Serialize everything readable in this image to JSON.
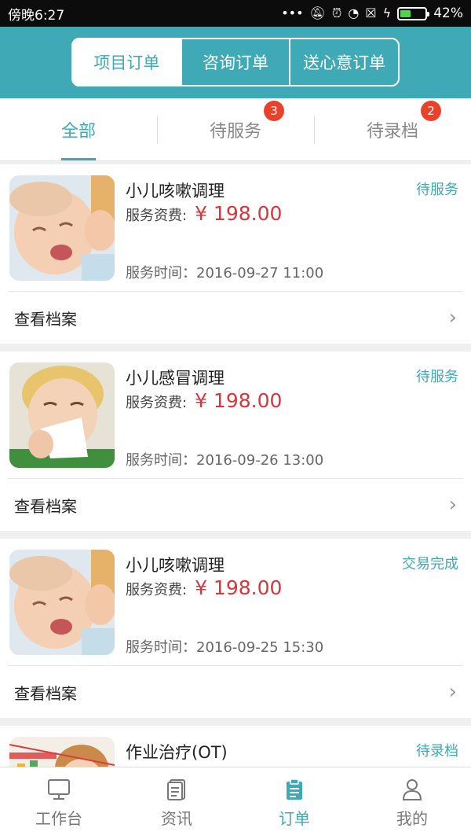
{
  "status_bar": {
    "left_text": "傍晚6:27",
    "battery": "42%",
    "battery_level": 0.42
  },
  "segments": {
    "items": [
      "项目订单",
      "咨询订单",
      "送心意订单"
    ],
    "active": 0
  },
  "subtabs": [
    {
      "label": "全部",
      "badge": ""
    },
    {
      "label": "待服务",
      "badge": "3"
    },
    {
      "label": "待录档",
      "badge": "2"
    }
  ],
  "colors": {
    "accent": "#3fa9b5",
    "price": "#d8363c",
    "badge": "#e8432a"
  },
  "orders": [
    {
      "title": "小儿咳嗽调理",
      "status": "待服务",
      "fee_label": "服务资费:",
      "fee": "¥ 198.00",
      "time": "服务时间：2016-09-27 11:00",
      "action": "查看档案"
    },
    {
      "title": "小儿感冒调理",
      "status": "待服务",
      "fee_label": "服务资费:",
      "fee": "¥ 198.00",
      "time": "服务时间：2016-09-26 13:00",
      "action": "查看档案"
    },
    {
      "title": "小儿咳嗽调理",
      "status": "交易完成",
      "fee_label": "服务资费:",
      "fee": "¥ 198.00",
      "time": "服务时间：2016-09-25 15:30",
      "action": "查看档案"
    },
    {
      "title": "作业治疗(OT)",
      "status": "待录档"
    }
  ],
  "bottom_nav": [
    {
      "label": "工作台",
      "icon": "monitor-icon"
    },
    {
      "label": "资讯",
      "icon": "document-icon"
    },
    {
      "label": "订单",
      "icon": "clipboard-icon"
    },
    {
      "label": "我的",
      "icon": "person-icon"
    }
  ]
}
